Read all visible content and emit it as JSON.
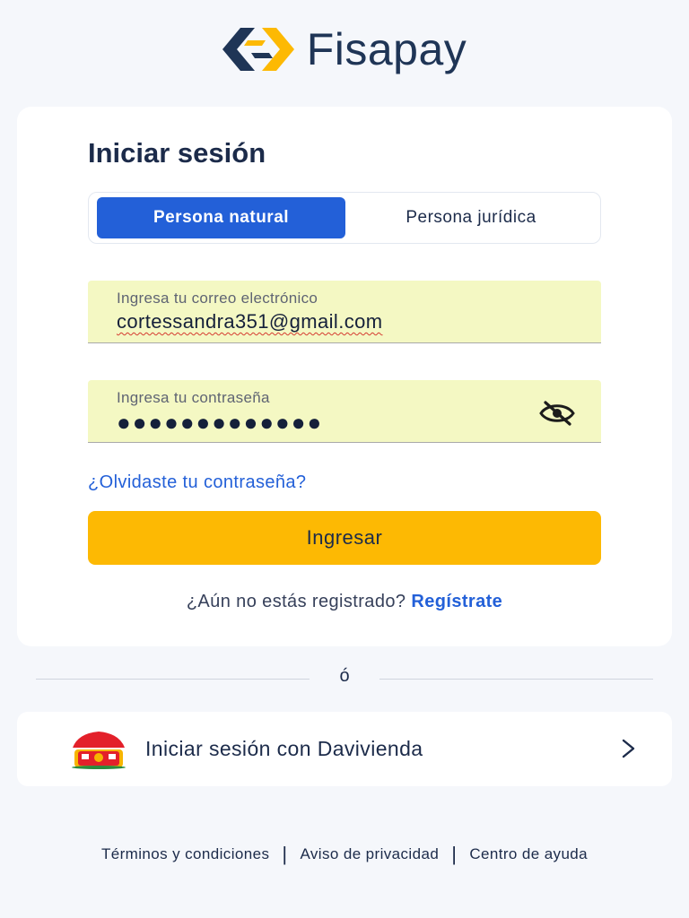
{
  "brand": {
    "name": "Fisapay"
  },
  "login": {
    "title": "Iniciar sesión",
    "tabs": [
      "Persona natural",
      "Persona jurídica"
    ],
    "email": {
      "label": "Ingresa tu correo electrónico",
      "value": "cortessandra351@gmail.com"
    },
    "password": {
      "label": "Ingresa tu contraseña",
      "masked": "●●●●●●●●●●●●●"
    },
    "forgot": "¿Olvidaste tu contraseña?",
    "submit": "Ingresar",
    "register_prompt": "¿Aún no estás registrado?",
    "register_link": "Regístrate"
  },
  "divider": "ó",
  "davivienda": {
    "label": "Iniciar sesión con Davivienda",
    "icon": "davivienda-house-icon"
  },
  "footer": {
    "links": [
      "Términos y condiciones",
      "Aviso de privacidad",
      "Centro de ayuda"
    ],
    "separator": "|"
  },
  "colors": {
    "primary": "#2360d8",
    "accent": "#fdb903",
    "input_bg": "#f4f8c3",
    "text": "#1c2b4a"
  }
}
